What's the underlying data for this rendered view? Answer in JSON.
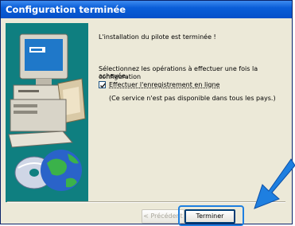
{
  "window": {
    "title": "Configuration terminée"
  },
  "content": {
    "line1": "L'installation du pilote est terminée !",
    "line2a": "Sélectionnez les opérations à effectuer une fois la configuration",
    "line2b": "achevée.",
    "checkbox_label": "Effectuer l'enregistrement en ligne",
    "checkbox_checked": true,
    "note": "(Ce service n'est pas disponible dans tous les pays.)"
  },
  "buttons": {
    "back_label": "< Précédent",
    "finish_label": "Terminer"
  },
  "colors": {
    "titlebar": "#0a5ed8",
    "art_background": "#0f7f80",
    "arrow": "#1e7fe0",
    "window": "#ece9d8"
  },
  "icons": [
    "computer-illustration",
    "cd-disc-icon",
    "globe-icon",
    "pointer-arrow"
  ]
}
